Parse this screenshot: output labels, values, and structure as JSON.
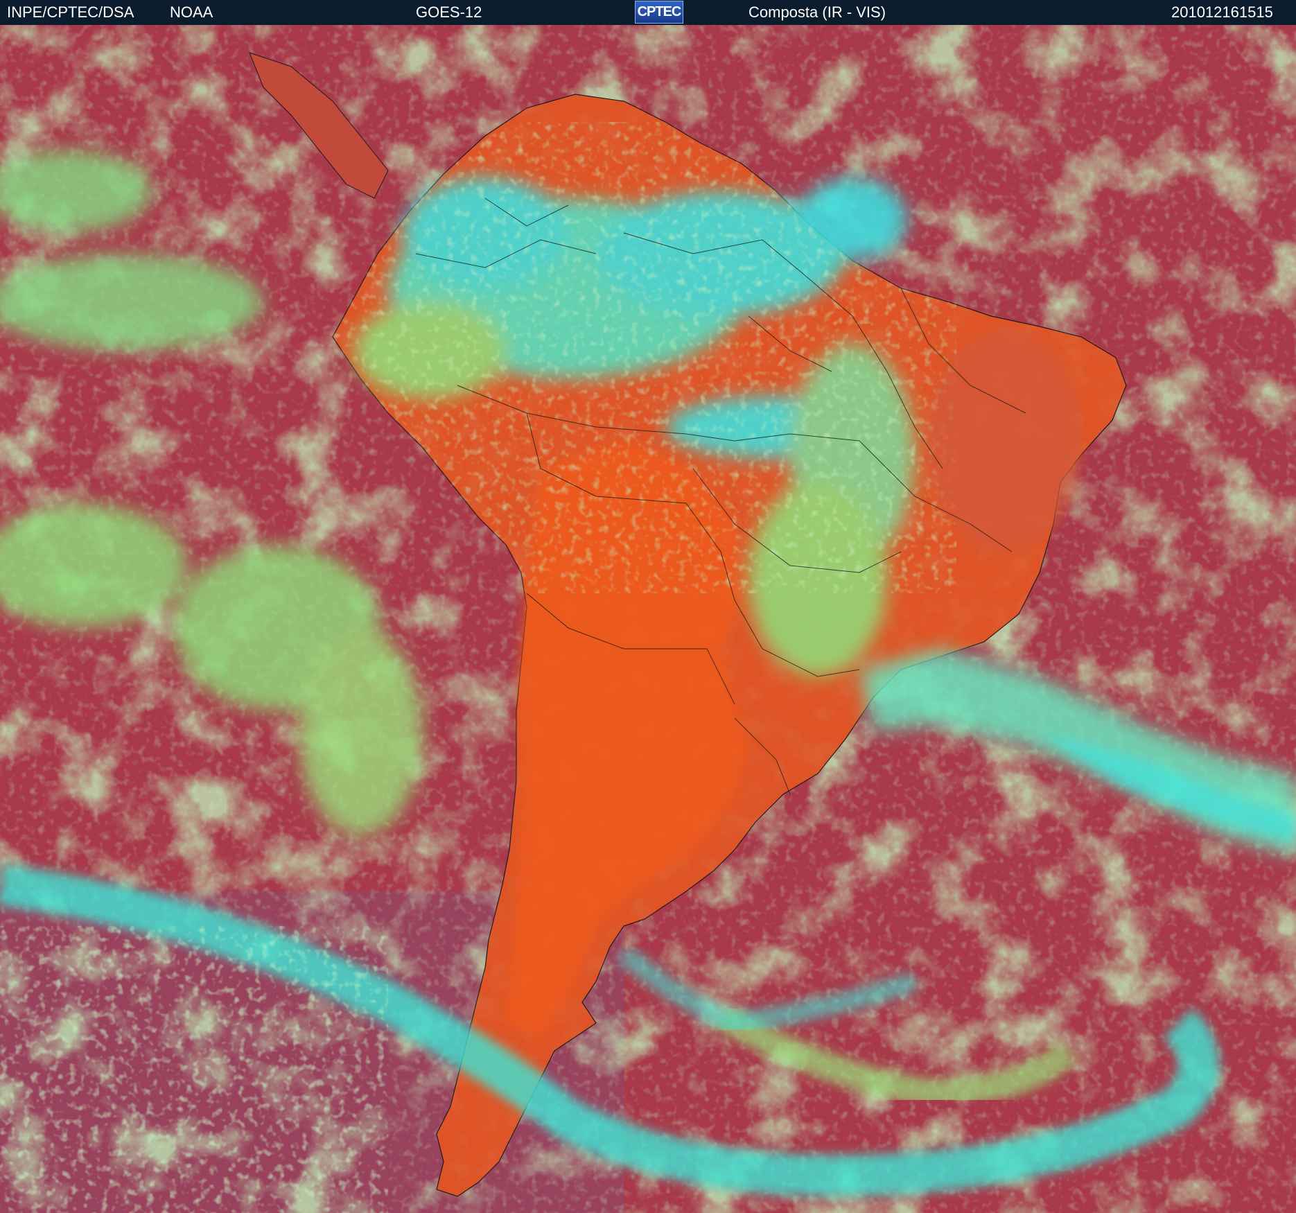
{
  "header": {
    "source": "INPE/CPTEC/DSA",
    "agency": "NOAA",
    "satellite": "GOES-12",
    "logo_text": "CPTEC",
    "product": "Composta (IR - VIS)",
    "timestamp": "201012161515"
  },
  "colors": {
    "header_bg": "#0b1c2c",
    "ocean": "#a8394a",
    "land": "#e2521e",
    "low_cloud": "#86e07c",
    "high_cloud": "#37e6e6",
    "border": "#111111"
  }
}
